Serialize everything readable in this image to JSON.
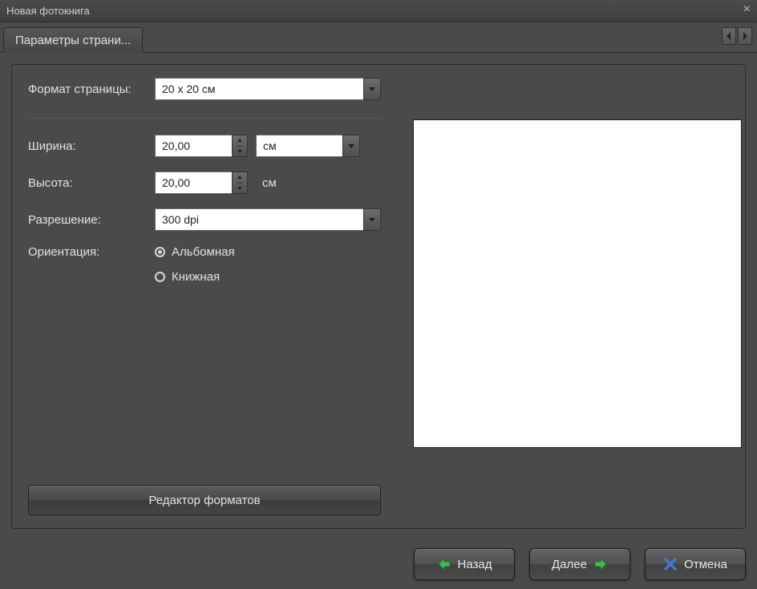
{
  "window": {
    "title": "Новая фотокнига"
  },
  "tabs": {
    "active": "Параметры страни..."
  },
  "form": {
    "page_format_label": "Формат страницы:",
    "page_format_value": "20 x 20 см",
    "width_label": "Ширина:",
    "width_value": "20,00",
    "width_unit": "см",
    "height_label": "Высота:",
    "height_value": "20,00",
    "height_unit": "см",
    "resolution_label": "Разрешение:",
    "resolution_value": "300 dpi",
    "orientation_label": "Ориентация:",
    "orientation_landscape": "Альбомная",
    "orientation_portrait": "Книжная",
    "format_editor_button": "Редактор форматов"
  },
  "footer": {
    "back": "Назад",
    "next": "Далее",
    "cancel": "Отмена"
  }
}
